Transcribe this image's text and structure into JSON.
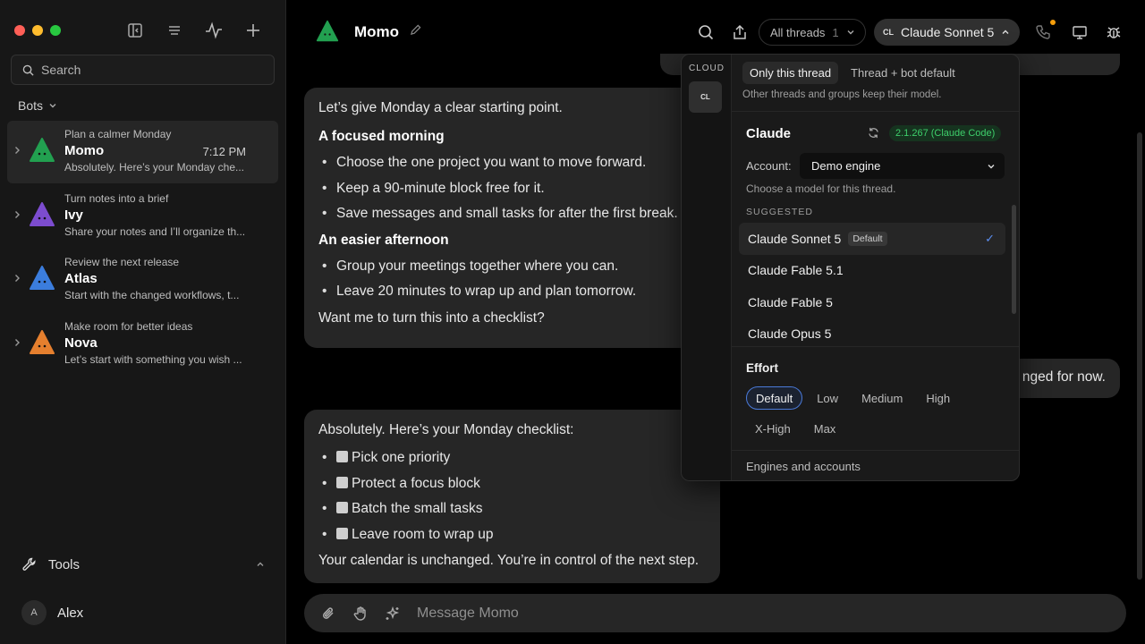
{
  "sidebar": {
    "search_placeholder": "Search",
    "bots_header": "Bots",
    "bots": [
      {
        "subtitle": "Plan a calmer Monday",
        "name": "Momo",
        "time": "7:12 PM",
        "preview": "Absolutely. Here’s your Monday che...",
        "color": "#22a050",
        "active": true
      },
      {
        "subtitle": "Turn notes into a brief",
        "name": "Ivy",
        "time": "",
        "preview": "Share your notes and I’ll organize th...",
        "color": "#7c4ccf",
        "active": false
      },
      {
        "subtitle": "Review the next release",
        "name": "Atlas",
        "time": "",
        "preview": "Start with the changed workflows, t...",
        "color": "#3b7ddd",
        "active": false
      },
      {
        "subtitle": "Make room for better ideas",
        "name": "Nova",
        "time": "",
        "preview": "Let’s start with something you wish ...",
        "color": "#e57f2e",
        "active": false
      }
    ],
    "tools_label": "Tools",
    "user_initial": "A",
    "user_name": "Alex"
  },
  "header": {
    "title": "Momo",
    "threads_label": "All threads",
    "threads_count": "1",
    "model_tag": "CL",
    "model_label": "Claude Sonnet 5"
  },
  "messages": {
    "m1": {
      "intro": "Let’s give Monday a clear starting point.",
      "h1": "A focused morning",
      "list1": [
        "Choose the one project you want to move forward.",
        "Keep a 90-minute block free for it.",
        "Save messages and small tasks for after the first break."
      ],
      "h2": "An easier afternoon",
      "list2": [
        "Group your meetings together where you can.",
        "Leave 20 minutes to wrap up and plan tomorrow."
      ],
      "outro": "Want me to turn this into a checklist?"
    },
    "user_reply": "nged for now.",
    "m2": {
      "intro": "Absolutely. Here’s your Monday checklist:",
      "items": [
        "Pick one priority",
        "Protect a focus block",
        "Batch the small tasks",
        "Leave room to wrap up"
      ],
      "outro": "Your calendar is unchanged. You’re in control of the next step."
    }
  },
  "composer": {
    "placeholder": "Message Momo"
  },
  "dropdown": {
    "rail_label": "CLOUD",
    "rail_btn": "CL",
    "scope_options": [
      "Only this thread",
      "Thread + bot default"
    ],
    "scope_note": "Other threads and groups keep their model.",
    "engine_name": "Claude",
    "engine_version": "2.1.267 (Claude Code)",
    "account_label": "Account:",
    "account_value": "Demo engine",
    "choose_text": "Choose a model for this thread.",
    "suggested_label": "SUGGESTED",
    "default_badge": "Default",
    "models": [
      "Claude Sonnet 5",
      "Claude Fable 5.1",
      "Claude Fable 5",
      "Claude Opus 5"
    ],
    "effort_title": "Effort",
    "effort_options": [
      "Default",
      "Low",
      "Medium",
      "High",
      "X-High",
      "Max"
    ],
    "engines_link": "Engines and accounts"
  }
}
